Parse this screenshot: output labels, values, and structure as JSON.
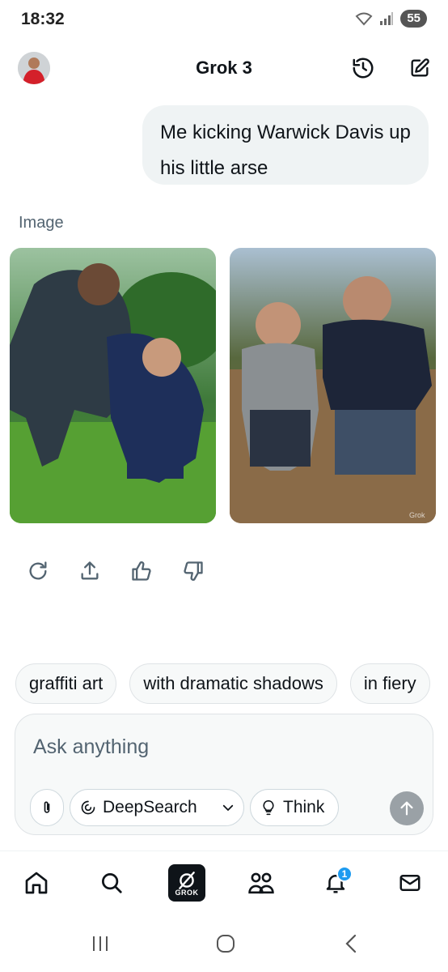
{
  "status": {
    "time": "18:32",
    "battery": "55",
    "wifi_icon": "wifi-icon",
    "signal_icon": "signal-icon"
  },
  "header": {
    "title": "Grok 3",
    "history_icon": "history-icon",
    "new_chat_icon": "edit-icon"
  },
  "messages": {
    "user_text": "Me kicking Warwick Davis up his little arse",
    "image_label": "Image",
    "watermark": "Grok"
  },
  "actions": [
    "regenerate-icon",
    "share-icon",
    "thumbs-up-icon",
    "thumbs-down-icon"
  ],
  "suggestions": [
    "graffiti art",
    "with dramatic shadows",
    "in fiery"
  ],
  "composer": {
    "placeholder": "Ask anything",
    "deepsearch_label": "DeepSearch",
    "think_label": "Think"
  },
  "nav": {
    "grok_label": "GROK",
    "notification_count": "1"
  },
  "colors": {
    "accent": "#1d9bf0",
    "bubble": "#eff3f4",
    "text": "#0f1419",
    "muted": "#536471"
  }
}
